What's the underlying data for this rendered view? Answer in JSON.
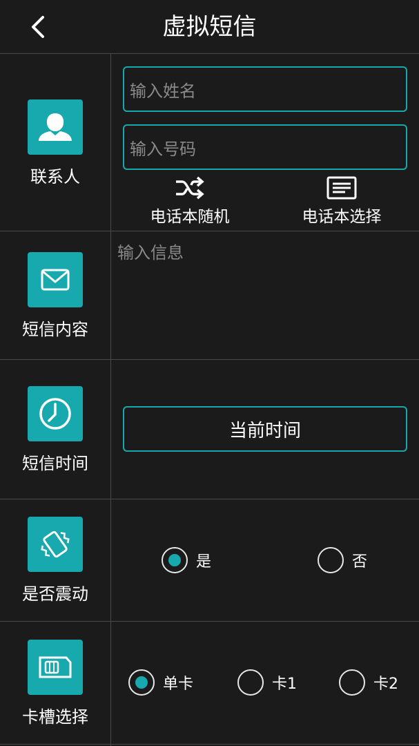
{
  "header": {
    "title": "虚拟短信"
  },
  "contact": {
    "label": "联系人",
    "name_placeholder": "输入姓名",
    "number_placeholder": "输入号码",
    "random_label": "电话本随机",
    "select_label": "电话本选择"
  },
  "message": {
    "label": "短信内容",
    "placeholder": "输入信息"
  },
  "time": {
    "label": "短信时间",
    "button_label": "当前时间"
  },
  "vibrate": {
    "label": "是否震动",
    "options": [
      {
        "label": "是",
        "selected": true
      },
      {
        "label": "否",
        "selected": false
      }
    ]
  },
  "sim": {
    "label": "卡槽选择",
    "options": [
      {
        "label": "单卡",
        "selected": true
      },
      {
        "label": "卡1",
        "selected": false
      },
      {
        "label": "卡2",
        "selected": false
      }
    ]
  },
  "colors": {
    "accent": "#17a9ad",
    "background": "#1b1b1b",
    "divider": "#4a4a4a",
    "placeholder": "#8a8a8a"
  },
  "icons": [
    "back-arrow-icon",
    "person-icon",
    "shuffle-icon",
    "list-icon",
    "envelope-icon",
    "clock-icon",
    "vibrate-icon",
    "sim-card-icon"
  ]
}
